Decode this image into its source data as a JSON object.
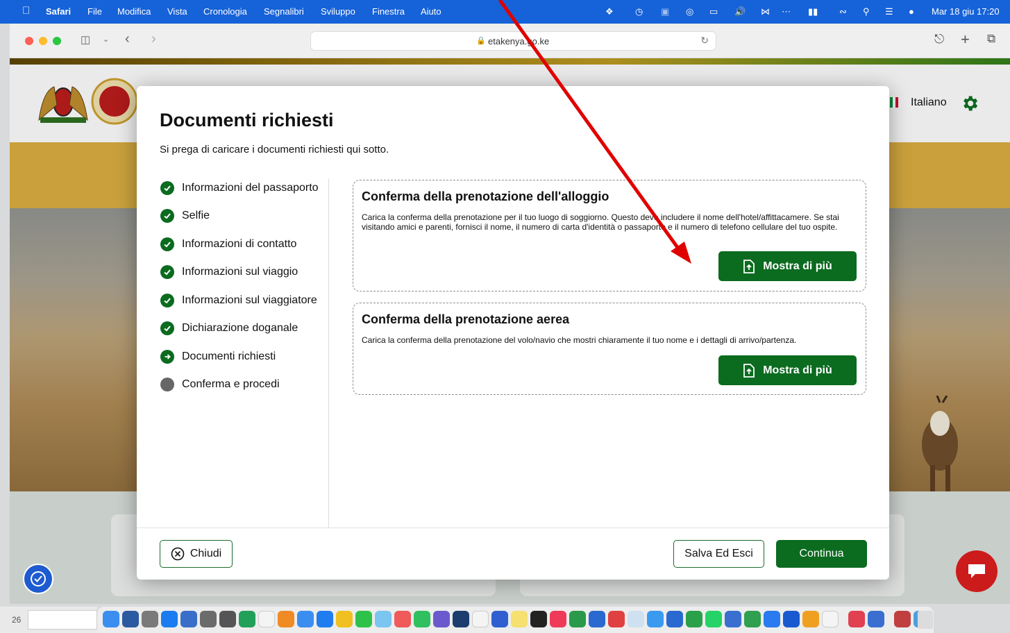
{
  "menubar": {
    "app": "Safari",
    "items": [
      "File",
      "Modifica",
      "Vista",
      "Cronologia",
      "Segnalibri",
      "Sviluppo",
      "Finestra",
      "Aiuto"
    ],
    "datetime": "Mar 18 giu 17:20"
  },
  "browser": {
    "url": "etakenya.go.ke"
  },
  "site": {
    "language": "Italiano"
  },
  "modal": {
    "title": "Documenti richiesti",
    "subtitle": "Si prega di caricare i documenti richiesti qui sotto.",
    "steps": [
      {
        "label": "Informazioni del passaporto",
        "status": "done"
      },
      {
        "label": "Selfie",
        "status": "done"
      },
      {
        "label": "Informazioni di contatto",
        "status": "done"
      },
      {
        "label": "Informazioni sul viaggio",
        "status": "done"
      },
      {
        "label": "Informazioni sul viaggiatore",
        "status": "done"
      },
      {
        "label": "Dichiarazione doganale",
        "status": "done"
      },
      {
        "label": "Documenti richiesti",
        "status": "current"
      },
      {
        "label": "Conferma e procedi",
        "status": "pending"
      }
    ],
    "documents": [
      {
        "title": "Conferma della prenotazione dell'alloggio",
        "description": "Carica la conferma della prenotazione per il tuo luogo di soggiorno. Questo deve includere il nome dell'hotel/affittacamere. Se stai visitando amici e parenti, fornisci il nome, il numero di carta d'identità o passaporto e il numero di telefono cellulare del tuo ospite.",
        "button": "Mostra di più"
      },
      {
        "title": "Conferma della prenotazione aerea",
        "description": "Carica la conferma della prenotazione del volo/navio che mostri chiaramente il tuo nome e i dettagli di arrivo/partenza.",
        "button": "Mostra di più"
      }
    ],
    "close_label": "Chiudi",
    "save_label": "Salva Ed Esci",
    "continue_label": "Continua"
  },
  "desktop": {
    "left_edge_number": "26"
  },
  "colors": {
    "primary_green": "#0b6b1f",
    "pending_gray": "#666666",
    "menubar_blue": "#1662d8",
    "annotation_red": "#e00000",
    "chat_red": "#cc1b1b"
  }
}
